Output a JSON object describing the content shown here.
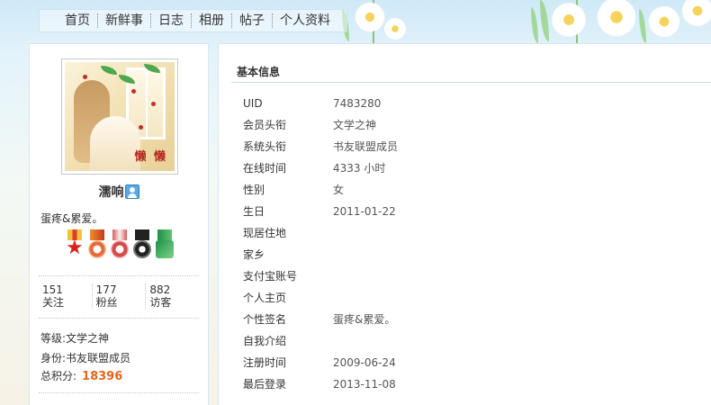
{
  "nav": {
    "items": [
      "首页",
      "新鲜事",
      "日志",
      "相册",
      "帖子",
      "个人资料"
    ]
  },
  "profile": {
    "avatar_text": "懒 懒",
    "username": "濡响",
    "signature": "蛋疼&累爱。",
    "stats": [
      {
        "num": "151",
        "label": "关注"
      },
      {
        "num": "177",
        "label": "粉丝"
      },
      {
        "num": "882",
        "label": "访客"
      }
    ],
    "level_label": "等级:",
    "level_value": "文学之神",
    "identity_label": "身份:",
    "identity_value": "书友联盟成员",
    "points_label": "总积分:",
    "points_value": "18396"
  },
  "basic_info": {
    "title": "基本信息",
    "rows": [
      {
        "label": "UID",
        "value": "7483280"
      },
      {
        "label": "会员头衔",
        "value": "文学之神"
      },
      {
        "label": "系统头衔",
        "value": "书友联盟成员"
      },
      {
        "label": "在线时间",
        "value": "4333 小时"
      },
      {
        "label": "性别",
        "value": "女"
      },
      {
        "label": "生日",
        "value": "2011-01-22"
      },
      {
        "label": "现居住地",
        "value": ""
      },
      {
        "label": "家乡",
        "value": ""
      },
      {
        "label": "支付宝账号",
        "value": ""
      },
      {
        "label": "个人主页",
        "value": ""
      },
      {
        "label": "个性签名",
        "value": "蛋疼&累爱。"
      },
      {
        "label": "自我介绍",
        "value": ""
      },
      {
        "label": "注册时间",
        "value": "2009-06-24"
      },
      {
        "label": "最后登录",
        "value": "2013-11-08"
      }
    ]
  },
  "colors": {
    "points": "#e8661a",
    "border": "#d9e6ee",
    "section_line": "#c4dfe8"
  }
}
